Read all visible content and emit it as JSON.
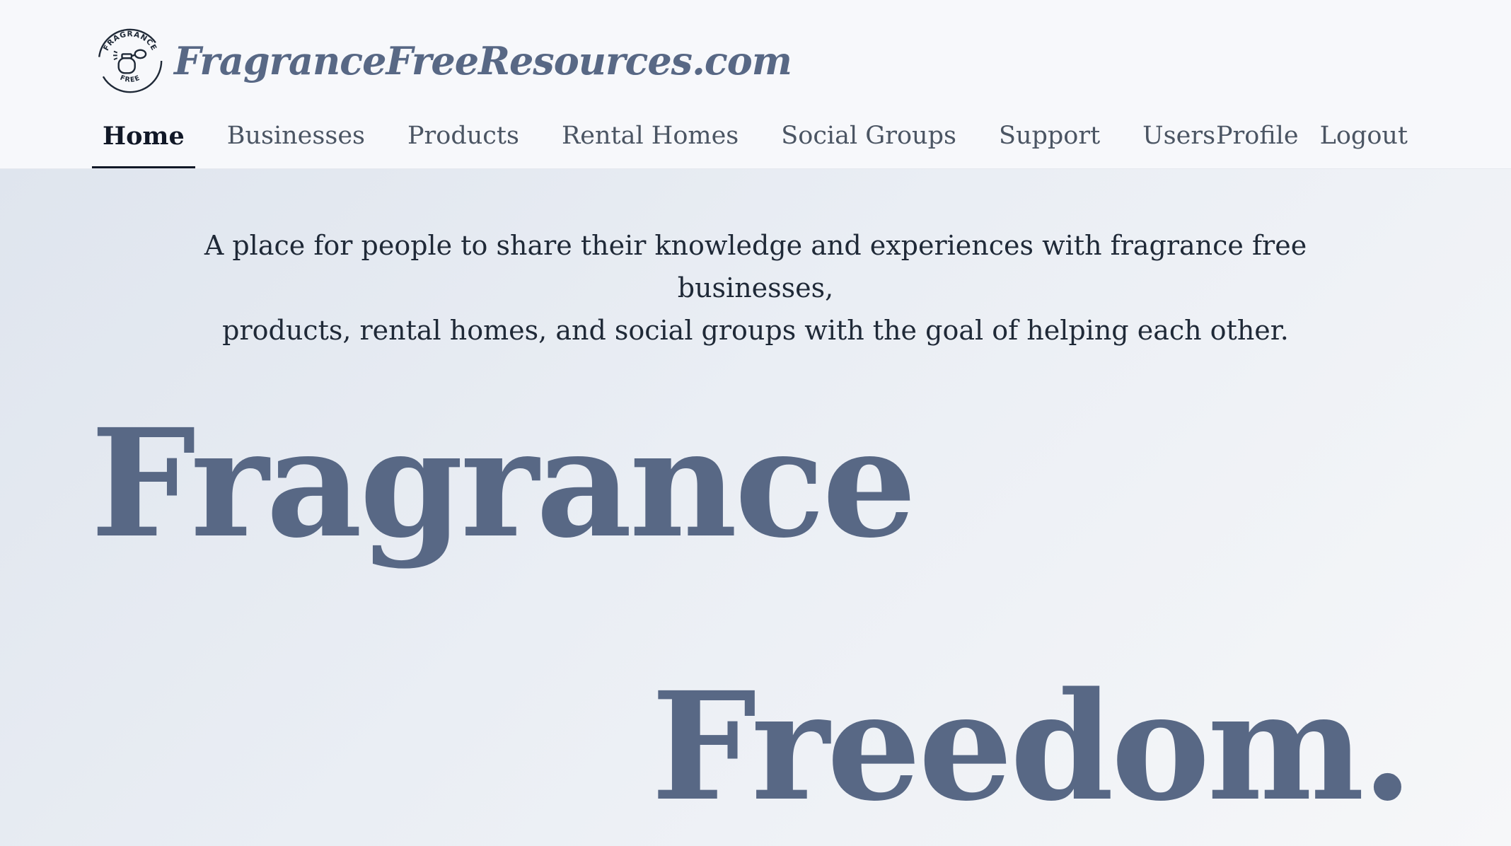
{
  "header": {
    "site_title": "FragranceFreeResources.com",
    "logo": {
      "icon": "perfume-bottle-icon",
      "top_text": "FRAGRANCE",
      "bottom_text": "FREE"
    }
  },
  "nav": {
    "items": [
      {
        "label": "Home",
        "active": true
      },
      {
        "label": "Businesses",
        "active": false
      },
      {
        "label": "Products",
        "active": false
      },
      {
        "label": "Rental Homes",
        "active": false
      },
      {
        "label": "Social Groups",
        "active": false
      },
      {
        "label": "Support",
        "active": false
      },
      {
        "label": "Users",
        "active": false
      }
    ],
    "right": {
      "profile": "Profile",
      "logout": "Logout"
    }
  },
  "hero": {
    "tagline_line1": "A place for people to share their knowledge and experiences with fragrance free businesses,",
    "tagline_line2": "products, rental homes, and social groups with the goal of helping each other.",
    "headline_word1": "Fragrance",
    "headline_word2": "Freedom."
  },
  "colors": {
    "brand": "#586885",
    "text": "#1f2937",
    "nav_text": "#4b5563",
    "active_underline": "#111827"
  }
}
